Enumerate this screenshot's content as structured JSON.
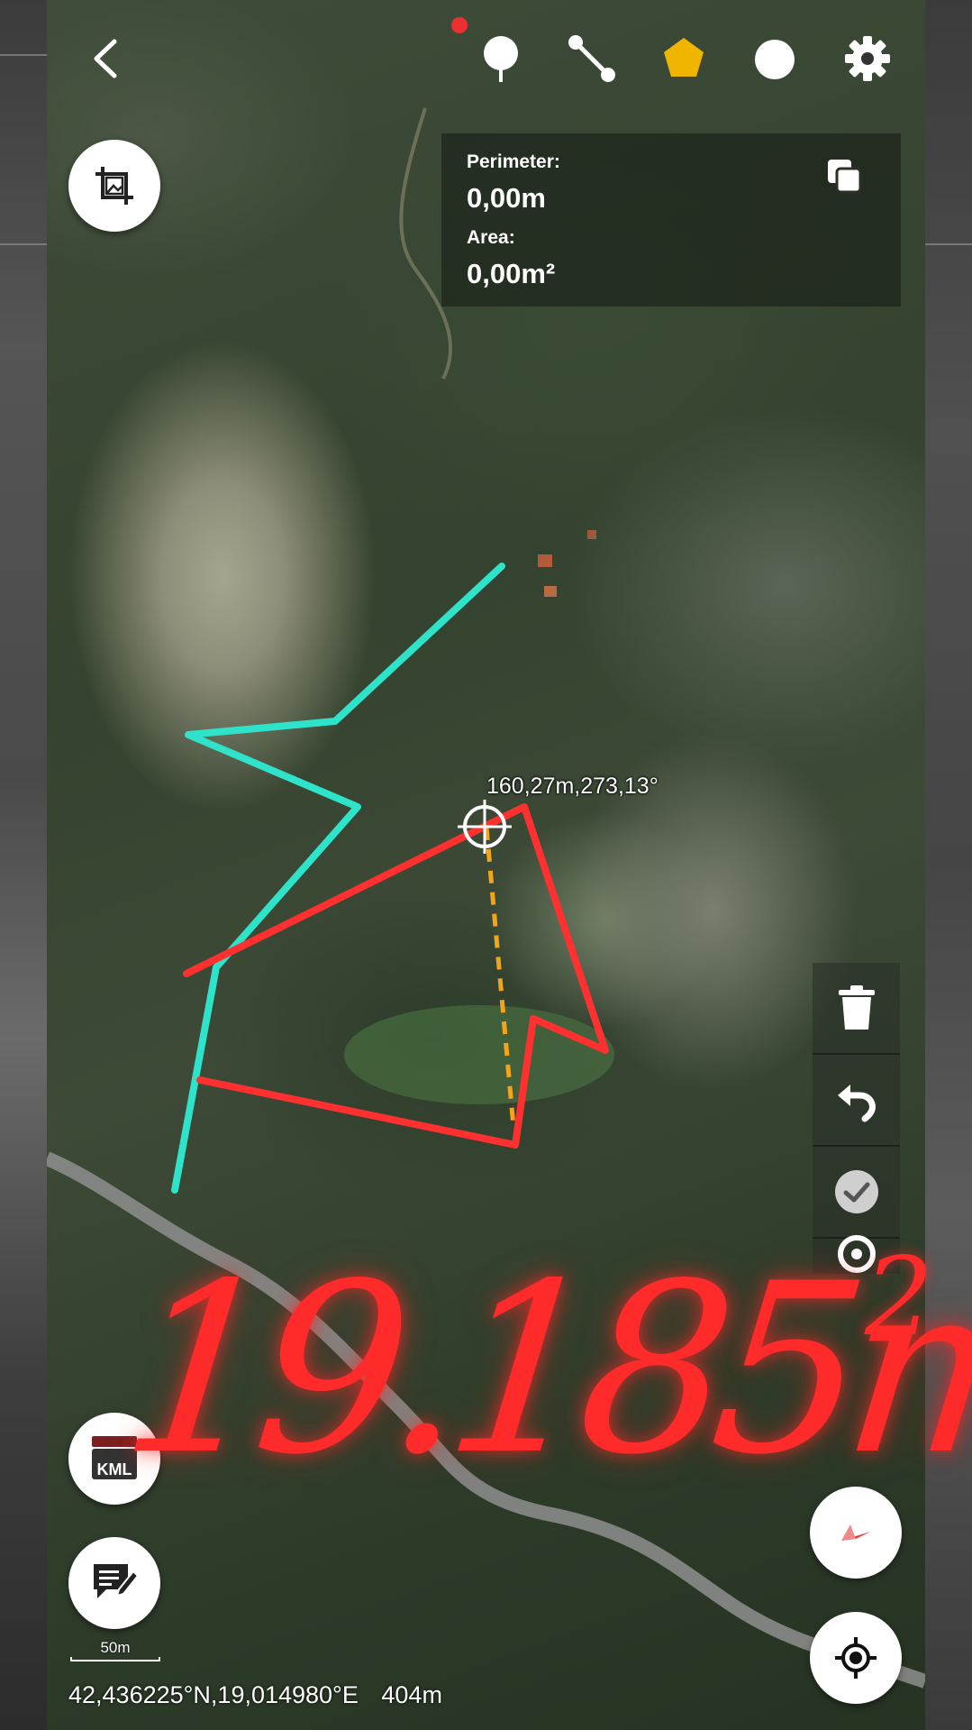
{
  "toolbar": {
    "back_icon": "back-arrow-icon",
    "marker_icon": "pin-icon",
    "line_icon": "line-segment-icon",
    "polygon_icon": "polygon-icon",
    "circle_icon": "circle-icon",
    "settings_icon": "gear-icon",
    "polygon_color": "#f0b500"
  },
  "stats": {
    "perimeter_label": "Perimeter:",
    "perimeter_value": "0,00m",
    "area_label": "Area:",
    "area_value": "0,00m²"
  },
  "measurement_label": "160,27m,273,13°",
  "annotation": {
    "text": "19.185m",
    "superscript": "2",
    "color": "#ff2b2b"
  },
  "tools": {
    "delete_icon": "trash-icon",
    "undo_icon": "undo-icon",
    "confirm_icon": "check-icon",
    "point_icon": "target-dot-icon"
  },
  "buttons": {
    "kml_label": "KML",
    "crop_icon": "crop-image-icon",
    "notes_icon": "note-edit-icon",
    "compass_icon": "compass-icon",
    "locate_icon": "locate-icon"
  },
  "scale": {
    "label": "50m"
  },
  "footer": {
    "coordinates": "42,436225°N,19,014980°E",
    "altitude": "404m"
  },
  "colors": {
    "cyan_track": "#2ee3c9",
    "red_polygon": "#ff3030",
    "dashed_line": "#f2a51a"
  }
}
